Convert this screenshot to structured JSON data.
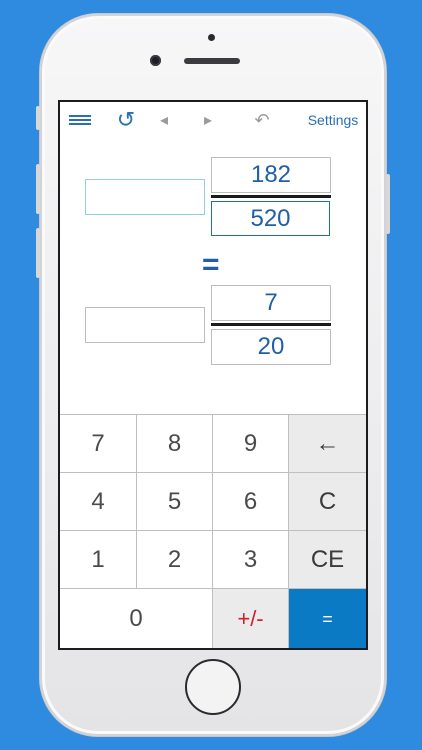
{
  "toolbar": {
    "menu_icon": "hamburger-menu-icon",
    "refresh_icon": "circular-arrow-icon",
    "prev_icon": "triangle-left-icon",
    "next_icon": "triangle-right-icon",
    "undo_icon": "undo-arrow-icon",
    "refresh_glyph": "↺",
    "prev_glyph": "◂",
    "next_glyph": "▸",
    "undo_glyph": "↶",
    "settings_label": "Settings"
  },
  "input_fraction": {
    "whole": "",
    "numerator": "182",
    "denominator": "520"
  },
  "equals_label": "=",
  "result_fraction": {
    "whole": "",
    "numerator": "7",
    "denominator": "20"
  },
  "keypad": {
    "k7": "7",
    "k8": "8",
    "k9": "9",
    "backspace": "←",
    "k4": "4",
    "k5": "5",
    "k6": "6",
    "clear": "C",
    "k1": "1",
    "k2": "2",
    "k3": "3",
    "clear_entry": "CE",
    "k0": "0",
    "sign": "+/-",
    "equals": "="
  },
  "colors": {
    "background": "#2f8be0",
    "accent": "#2a6fb3",
    "equals_key": "#0a7ac4",
    "sign_key_text": "#d0212b"
  }
}
